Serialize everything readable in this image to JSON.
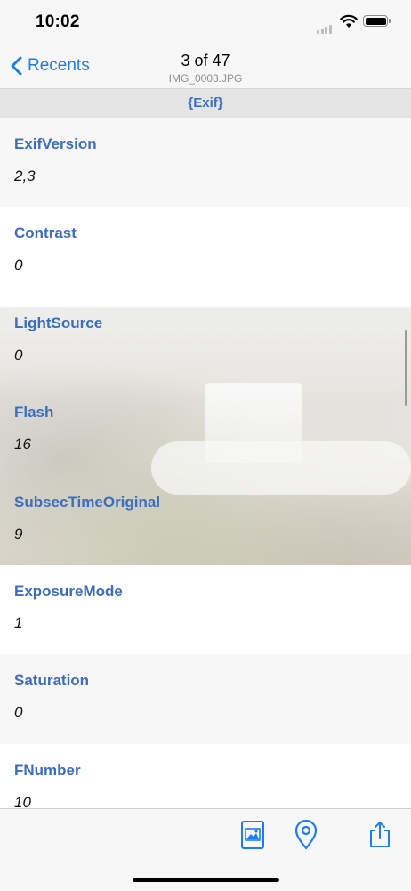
{
  "status_bar": {
    "time": "10:02"
  },
  "nav": {
    "back_label": "Recents",
    "title": "3 of 47",
    "subtitle": "IMG_0003.JPG"
  },
  "section": {
    "title": "{Exif}"
  },
  "rows": [
    {
      "key": "ExifVersion",
      "value": "2,3"
    },
    {
      "key": "Contrast",
      "value": "0"
    },
    {
      "key": "LightSource",
      "value": "0"
    },
    {
      "key": "Flash",
      "value": "16"
    },
    {
      "key": "SubsecTimeOriginal",
      "value": "9"
    },
    {
      "key": "ExposureMode",
      "value": "1"
    },
    {
      "key": "Saturation",
      "value": "0"
    },
    {
      "key": "FNumber",
      "value": "10"
    }
  ],
  "toolbar": {
    "buttons": [
      {
        "icon": "photo-icon"
      },
      {
        "icon": "location-pin-icon"
      },
      {
        "icon": "share-icon"
      }
    ]
  },
  "colors": {
    "accent": "#1e7cf2",
    "key_text": "#3d6dbf",
    "section_bg": "#e4e4e4"
  }
}
